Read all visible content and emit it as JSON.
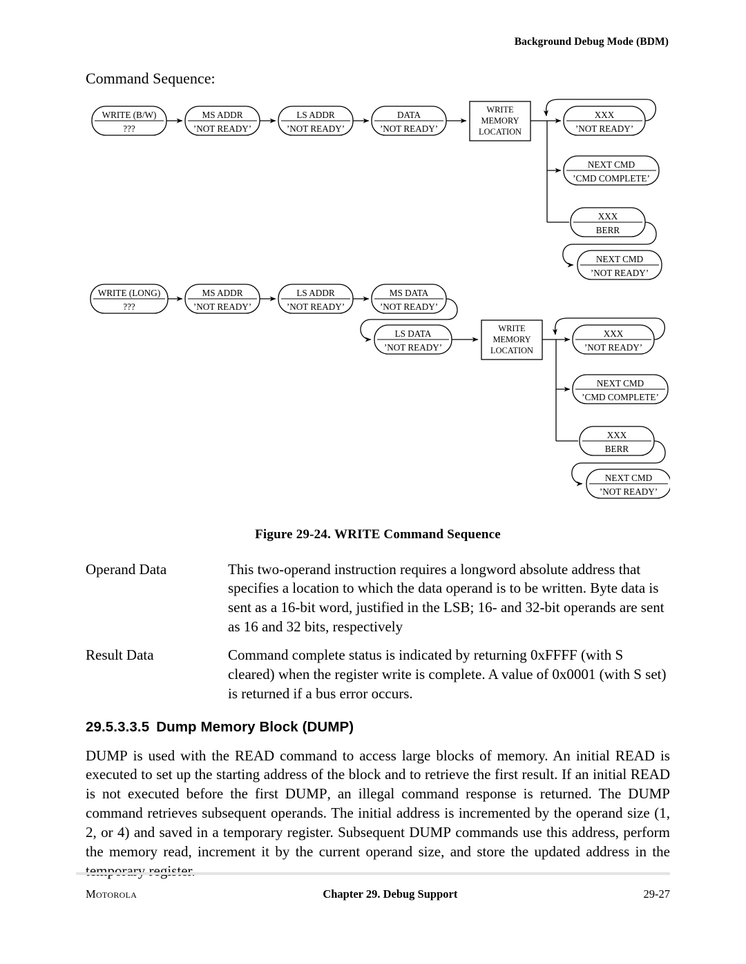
{
  "running_head": "Background Debug Mode (BDM)",
  "lead_label": "Command Sequence:",
  "figure": {
    "caption_prefix": "Figure 29-24. ",
    "caption_smallcaps": "WRITE",
    "caption_suffix": " Command Sequence",
    "flow_bw": {
      "chain": [
        {
          "top": "WRITE (B/W)",
          "bottom": "???"
        },
        {
          "top": "MS ADDR",
          "bottom": "’NOT READY’"
        },
        {
          "top": "LS ADDR",
          "bottom": "’NOT READY’"
        },
        {
          "top": "DATA",
          "bottom": "’NOT READY’"
        }
      ],
      "process": {
        "line1": "WRITE",
        "line2": "MEMORY",
        "line3": "LOCATION"
      },
      "branches": [
        {
          "top": "XXX",
          "bottom": "’NOT READY’"
        },
        {
          "top": "NEXT CMD",
          "bottom": "’CMD COMPLETE’"
        },
        {
          "top": "XXX",
          "bottom": "BERR"
        },
        {
          "top": "NEXT CMD",
          "bottom": "’NOT READY’"
        }
      ]
    },
    "flow_long": {
      "chain": [
        {
          "top": "WRITE (LONG)",
          "bottom": "???"
        },
        {
          "top": "MS ADDR",
          "bottom": "’NOT READY’"
        },
        {
          "top": "LS ADDR",
          "bottom": "’NOT READY’"
        },
        {
          "top": "MS DATA",
          "bottom": "’NOT READY’"
        }
      ],
      "second_row": {
        "top": "LS DATA",
        "bottom": "’NOT READY’"
      },
      "process": {
        "line1": "WRITE",
        "line2": "MEMORY",
        "line3": "LOCATION"
      },
      "branches": [
        {
          "top": "XXX",
          "bottom": "’NOT READY’"
        },
        {
          "top": "NEXT CMD",
          "bottom": "’CMD COMPLETE’"
        },
        {
          "top": "XXX",
          "bottom": "BERR"
        },
        {
          "top": "NEXT CMD",
          "bottom": "’NOT READY’"
        }
      ]
    }
  },
  "definitions": [
    {
      "term": "Operand Data",
      "desc": "This two-operand instruction requires a longword absolute address that specifies a location to which the data operand is to be written. Byte data is sent as a 16-bit word, justified in the LSB; 16- and 32-bit operands are sent as 16 and 32 bits, respectively"
    },
    {
      "term": "Result Data",
      "desc": "Command complete status is indicated by returning 0xFFFF (with S cleared) when the register write is complete. A value of 0x0001 (with S set) is returned if a bus error occurs."
    }
  ],
  "section": {
    "number": "29.5.3.3.5",
    "title_prefix": "Dump Memory Block (",
    "title_smallcaps": "DUMP",
    "title_suffix": ")"
  },
  "paragraph": {
    "p1": "DUMP",
    "p2": " is used with the ",
    "p3": "READ",
    "p4": " command to access large blocks of memory. An initial ",
    "p5": "READ",
    "p6": " is executed to set up the starting address of the block and to retrieve the first result. If an initial ",
    "p7": "READ",
    "p8": " is not executed before the first ",
    "p9": "DUMP",
    "p10": ", an illegal command response is returned. The ",
    "p11": "DUMP",
    "p12": " command retrieves subsequent operands. The initial address is incremented by the operand size (1, 2, or 4) and saved in a temporary register. Subsequent ",
    "p13": "DUMP",
    "p14": " commands use this address, perform the memory read, increment it by the current operand size, and store the updated address in the temporary register."
  },
  "footer": {
    "left": "Motorola",
    "center": "Chapter 29. Debug Support",
    "right": "29-27"
  }
}
